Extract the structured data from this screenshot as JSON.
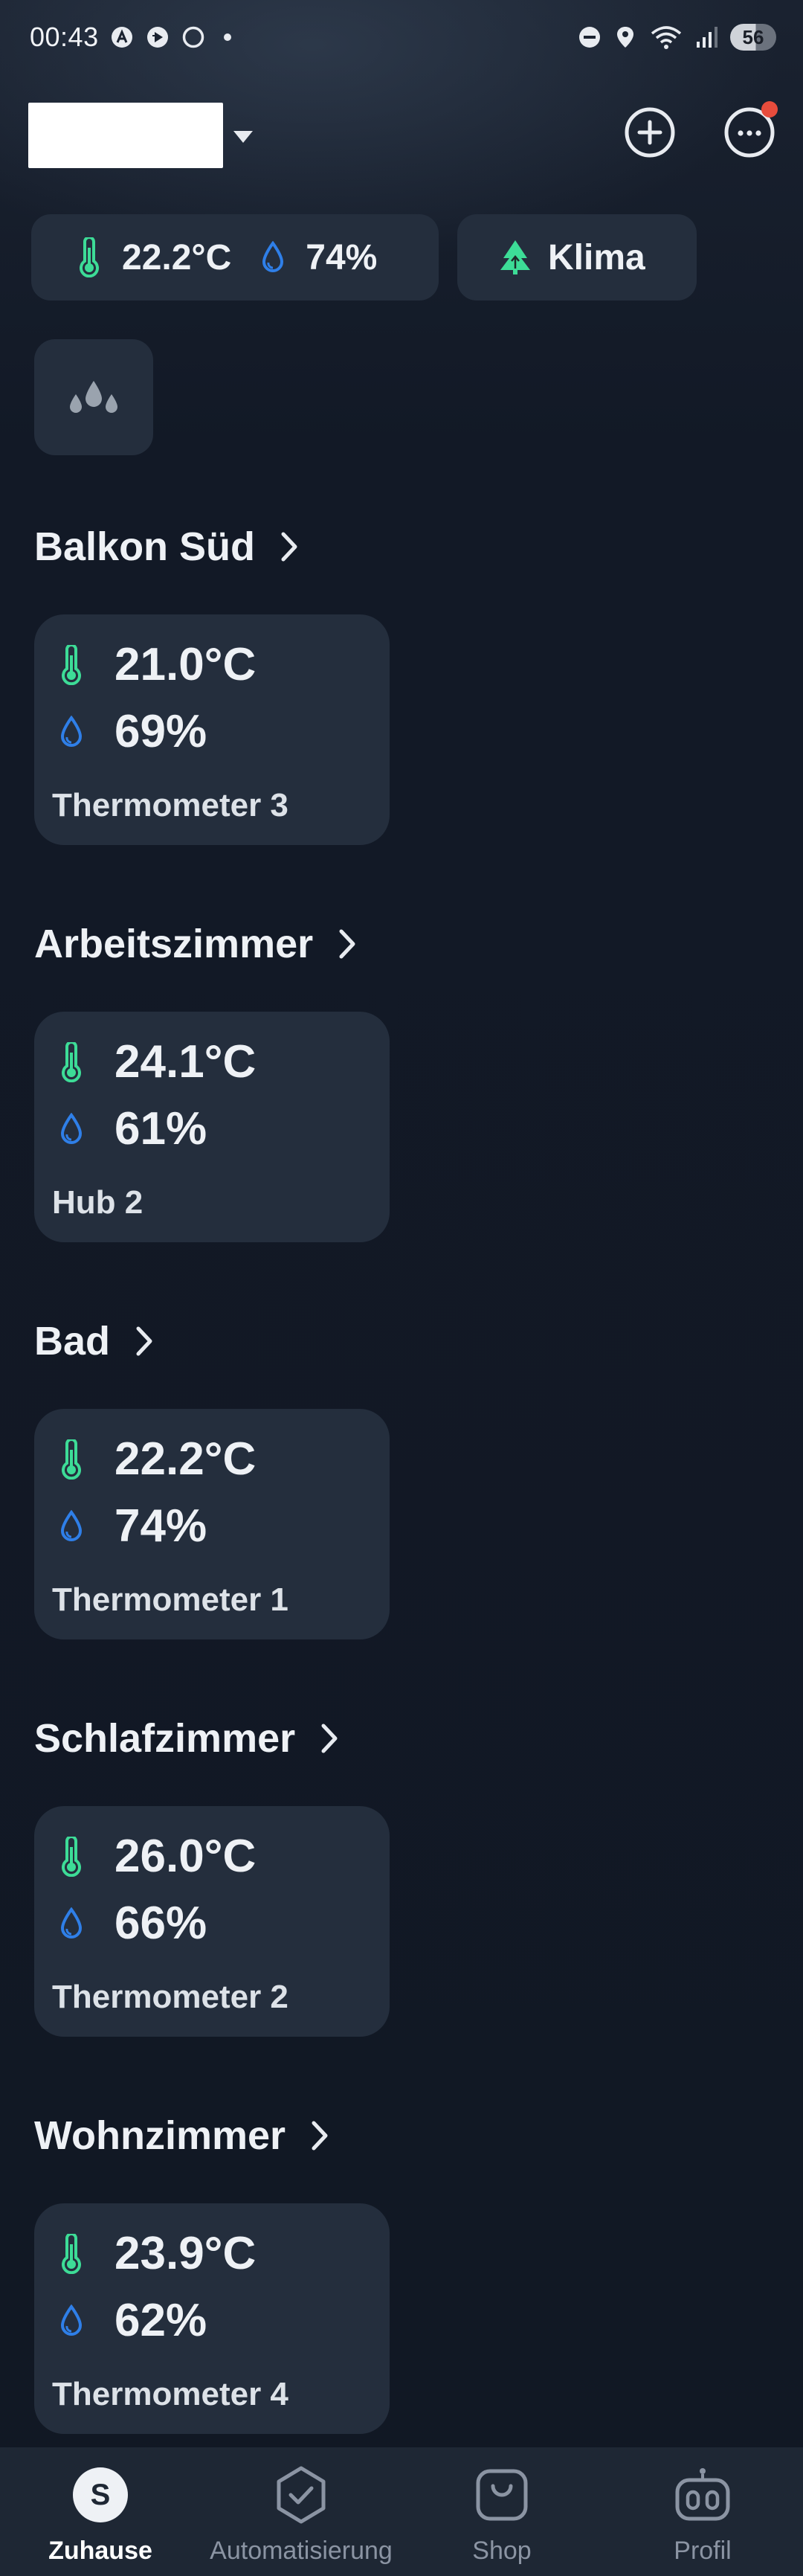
{
  "status_bar": {
    "time": "00:43",
    "battery": "56",
    "icons": [
      "app-a-icon",
      "app-play-icon",
      "circle-icon",
      "dot-icon",
      "dnd-icon",
      "location-icon",
      "wifi-icon",
      "signal-icon",
      "battery-icon"
    ]
  },
  "header": {
    "home_name": "",
    "add_icon": "plus-circle-icon",
    "more_icon": "more-circle-icon",
    "notification": true
  },
  "summary": {
    "temperature": "22.2°C",
    "humidity": "74%",
    "klima_label": "Klima"
  },
  "colors": {
    "background": "#111824",
    "card": "#242e3d",
    "thermo_green": "#3ddc97",
    "humidity_blue": "#2f7fe8",
    "notification_red": "#e74c3c"
  },
  "rooms": [
    {
      "name": "Balkon Süd",
      "device": "Thermometer 3",
      "temperature": "21.0°C",
      "humidity": "69%"
    },
    {
      "name": "Arbeitszimmer",
      "device": "Hub 2",
      "temperature": "24.1°C",
      "humidity": "61%"
    },
    {
      "name": "Bad",
      "device": "Thermometer 1",
      "temperature": "22.2°C",
      "humidity": "74%"
    },
    {
      "name": "Schlafzimmer",
      "device": "Thermometer 2",
      "temperature": "26.0°C",
      "humidity": "66%"
    },
    {
      "name": "Wohnzimmer",
      "device": "Thermometer 4",
      "temperature": "23.9°C",
      "humidity": "62%"
    }
  ],
  "nav": {
    "home_letter": "S",
    "items": [
      {
        "label": "Zuhause",
        "icon": "home-s-icon",
        "active": true
      },
      {
        "label": "Automatisierung",
        "icon": "check-shield-icon",
        "active": false
      },
      {
        "label": "Shop",
        "icon": "shopping-bag-icon",
        "active": false
      },
      {
        "label": "Profil",
        "icon": "robot-icon",
        "active": false
      }
    ]
  }
}
